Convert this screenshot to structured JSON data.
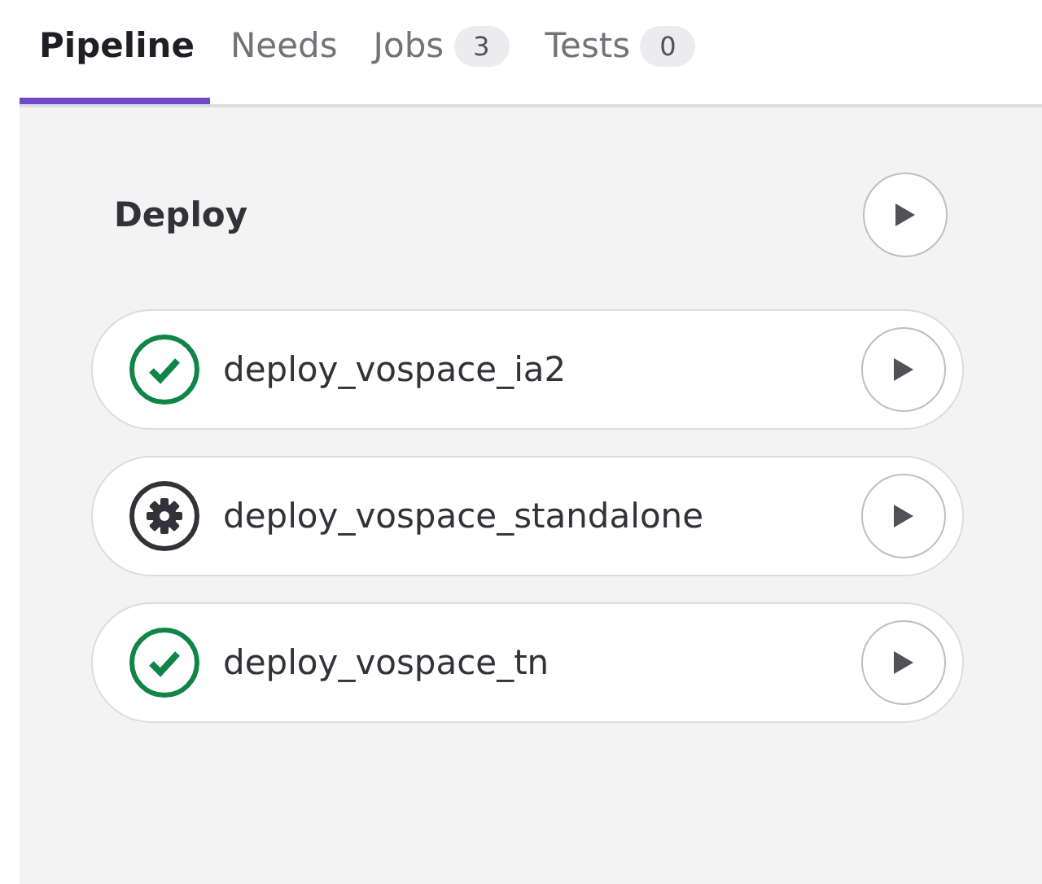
{
  "tabs": [
    {
      "label": "Pipeline",
      "selected": true
    },
    {
      "label": "Needs",
      "selected": false
    },
    {
      "label": "Jobs",
      "count": "3",
      "selected": false
    },
    {
      "label": "Tests",
      "count": "0",
      "selected": false
    }
  ],
  "stage": {
    "title": "Deploy",
    "jobs": [
      {
        "name": "deploy_vospace_ia2",
        "kind": "success"
      },
      {
        "name": "deploy_vospace_standalone",
        "kind": "manual"
      },
      {
        "name": "deploy_vospace_tn",
        "kind": "success"
      }
    ]
  }
}
